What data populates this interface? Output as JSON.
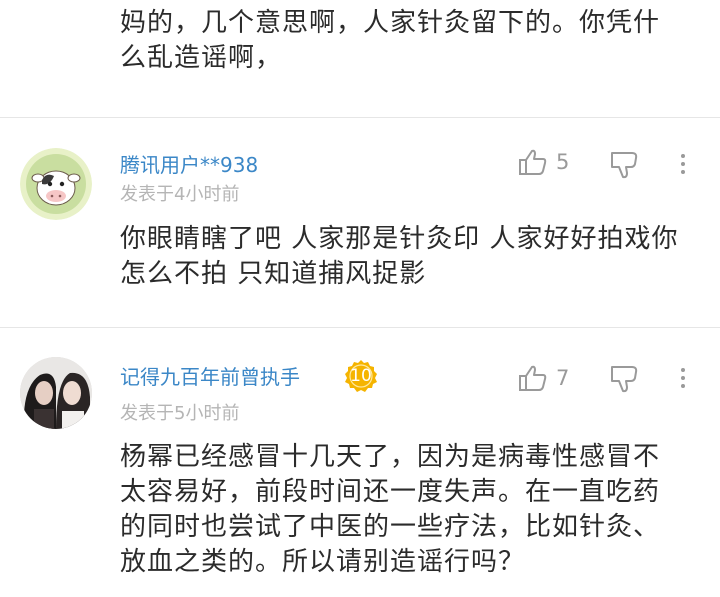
{
  "previous_comment": {
    "text": "妈的，几个意思啊，人家针灸留下的。你凭什么乱造谣啊，"
  },
  "comments": [
    {
      "username": "腾讯用户**938",
      "time": "发表于4小时前",
      "text": "你眼睛瞎了吧   人家那是针灸印  人家好好拍戏你怎么不拍   只知道捕风捉影",
      "likes": "5",
      "avatar_icon": "cow-avatar-icon"
    },
    {
      "username": "记得九百年前曾执手",
      "level": "10",
      "time": "发表于5小时前",
      "text": "杨幂已经感冒十几天了，因为是病毒性感冒不太容易好，前段时间还一度失声。在一直吃药的同时也尝试了中医的一些疗法，比如针灸、放血之类的。所以请别造谣行吗？",
      "likes": "7",
      "avatar_icon": "photo-avatar-icon"
    }
  ],
  "colors": {
    "username": "#3b87c7",
    "time": "#b5b5b5",
    "badge": "#f5b400",
    "icon": "#9a9a9a"
  }
}
